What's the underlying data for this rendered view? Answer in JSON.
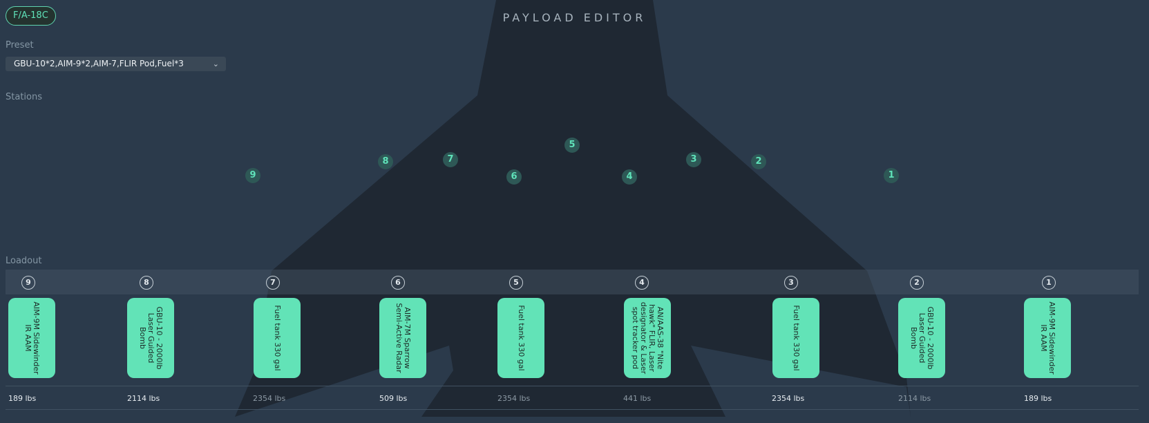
{
  "aircraft": {
    "name": "F/A-18C"
  },
  "page_title": "PAYLOAD EDITOR",
  "preset": {
    "label": "Preset",
    "selected": "GBU-10*2,AIM-9*2,AIM-7,FLIR Pod,Fuel*3"
  },
  "stations_label": "Stations",
  "station_markers": [
    "9",
    "8",
    "7",
    "6",
    "5",
    "4",
    "3",
    "2",
    "1"
  ],
  "loadout": {
    "label": "Loadout",
    "stations": [
      {
        "number": "9",
        "store": "AIM-9M Sidewinder IR AAM",
        "weight": "189 lbs"
      },
      {
        "number": "8",
        "store": "GBU-10 - 2000lb Laser Guided Bomb",
        "weight": "2114 lbs"
      },
      {
        "number": "7",
        "store": "Fuel tank 330 gal",
        "weight": "2354 lbs"
      },
      {
        "number": "6",
        "store": "AIM-7M Sparrow Semi-Active Radar",
        "weight": "509 lbs"
      },
      {
        "number": "5",
        "store": "Fuel tank 330 gal",
        "weight": "2354 lbs"
      },
      {
        "number": "4",
        "store": "AN/AAS-38 \"Nite hawk\" FLIR, Laser designator & Laser spot tracker pod",
        "weight": "441 lbs"
      },
      {
        "number": "3",
        "store": "Fuel tank 330 gal",
        "weight": "2354 lbs"
      },
      {
        "number": "2",
        "store": "GBU-10 - 2000lb Laser Guided Bomb",
        "weight": "2114 lbs"
      },
      {
        "number": "1",
        "store": "AIM-9M Sidewinder IR AAM",
        "weight": "189 lbs"
      }
    ]
  },
  "colors": {
    "background": "#2b3a4b",
    "silhouette": "#1f2833",
    "accent": "#62e3b7",
    "marker_fill": "#2e5856"
  }
}
